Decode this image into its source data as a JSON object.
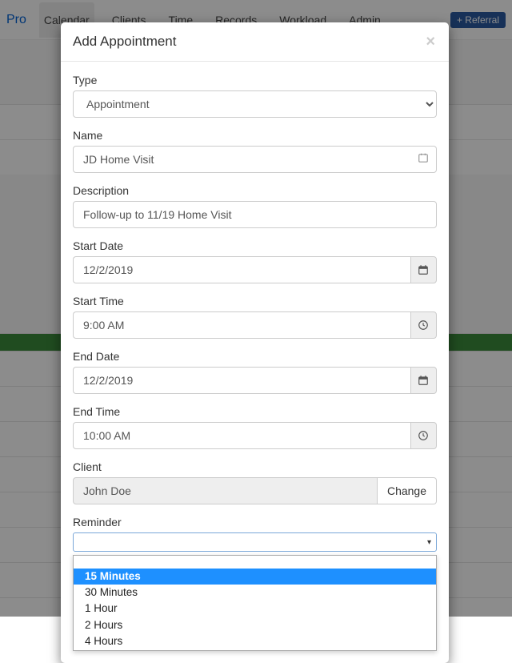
{
  "bg": {
    "logo": "Pro",
    "tabs": [
      "Calendar",
      "Clients",
      "Time",
      "Records",
      "Workload",
      "Admin"
    ],
    "referral": "+ Referral"
  },
  "modal": {
    "title": "Add Appointment",
    "fields": {
      "type": {
        "label": "Type",
        "value": "Appointment"
      },
      "name": {
        "label": "Name",
        "value": "JD Home Visit"
      },
      "description": {
        "label": "Description",
        "value": "Follow-up to 11/19 Home Visit"
      },
      "startDate": {
        "label": "Start Date",
        "value": "12/2/2019"
      },
      "startTime": {
        "label": "Start Time",
        "value": "9:00 AM"
      },
      "endDate": {
        "label": "End Date",
        "value": "12/2/2019"
      },
      "endTime": {
        "label": "End Time",
        "value": "10:00 AM"
      },
      "client": {
        "label": "Client",
        "value": "John Doe",
        "changeLabel": "Change"
      },
      "reminder": {
        "label": "Reminder",
        "options": [
          "",
          "15 Minutes",
          "30 Minutes",
          "1 Hour",
          "2 Hours",
          "4 Hours"
        ],
        "highlighted": "15 Minutes"
      }
    }
  }
}
